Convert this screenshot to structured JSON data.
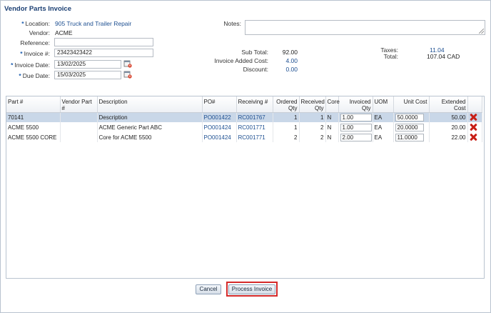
{
  "title": "Vendor Parts Invoice",
  "form": {
    "location_label": "Location:",
    "location_value": "905 Truck and Trailer Repair",
    "vendor_label": "Vendor:",
    "vendor_value": "ACME",
    "reference_label": "Reference:",
    "reference_value": "",
    "invoice_label": "Invoice #:",
    "invoice_value": "23423423422",
    "invoice_date_label": "Invoice Date:",
    "invoice_date_value": "13/02/2025",
    "due_date_label": "Due Date:",
    "due_date_value": "15/03/2025",
    "required_marker": "*",
    "notes_label": "Notes:",
    "notes_value": ""
  },
  "totals": {
    "subtotal_label": "Sub Total:",
    "subtotal_value": "92.00",
    "added_cost_label": "Invoice Added Cost:",
    "added_cost_value": "4.00",
    "discount_label": "Discount:",
    "discount_value": "0.00",
    "taxes_label": "Taxes:",
    "taxes_value": "11.04",
    "total_label": "Total:",
    "total_value": "107.04 CAD"
  },
  "grid": {
    "columns": [
      "Part #",
      "Vendor Part #",
      "Description",
      "PO#",
      "Receiving #",
      "Ordered Qty",
      "Received Qty",
      "Core",
      "Invoiced Qty",
      "UOM",
      "Unit Cost",
      "Extended Cost"
    ],
    "rows": [
      {
        "part": "70141",
        "vendor_part": "",
        "description": "Description",
        "po": "PO001422",
        "receiving": "RC001767",
        "ordered": "1",
        "received": "1",
        "core": "N",
        "invoiced": "1.00",
        "uom": "EA",
        "unit_cost": "50.0000",
        "extended": "50.00"
      },
      {
        "part": "ACME 5500",
        "vendor_part": "",
        "description": "ACME Generic Part ABC",
        "po": "PO001424",
        "receiving": "RC001771",
        "ordered": "1",
        "received": "2",
        "core": "N",
        "invoiced": "1.00",
        "uom": "EA",
        "unit_cost": "20.0000",
        "extended": "20.00"
      },
      {
        "part": "ACME 5500 CORE",
        "vendor_part": "",
        "description": "Core for ACME 5500",
        "po": "PO001424",
        "receiving": "RC001771",
        "ordered": "2",
        "received": "2",
        "core": "N",
        "invoiced": "2.00",
        "uom": "EA",
        "unit_cost": "11.0000",
        "extended": "22.00"
      }
    ]
  },
  "buttons": {
    "cancel": "Cancel",
    "process": "Process Invoice"
  },
  "colors": {
    "title": "#1b3f73",
    "link": "#1d4f91",
    "selected_row": "#c9d7e8",
    "delete_icon": "#c81e16",
    "highlight": "#d42a2a"
  }
}
